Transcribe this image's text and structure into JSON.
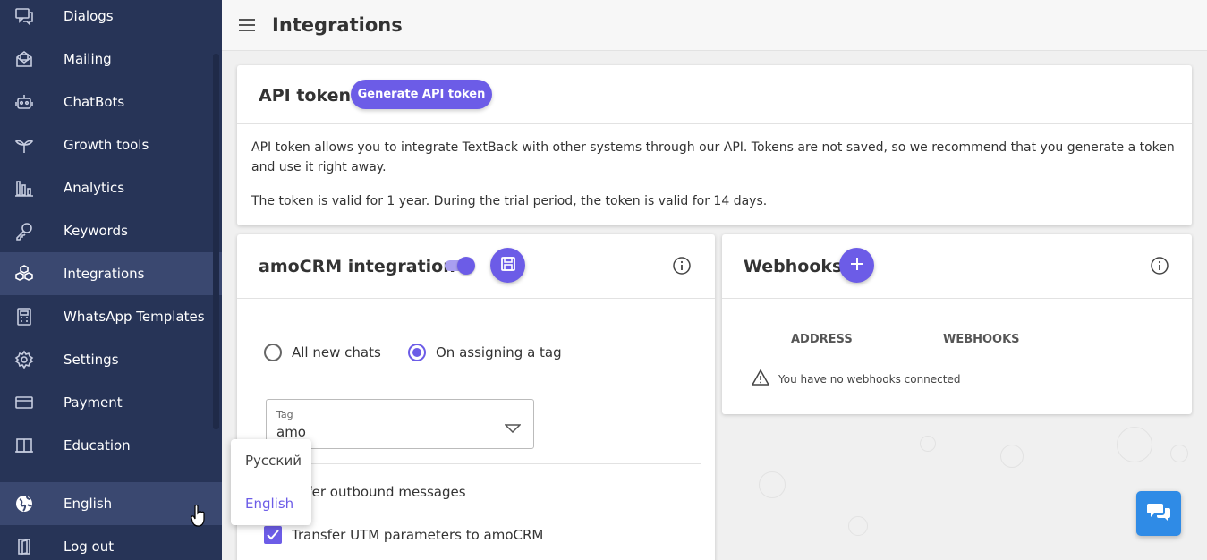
{
  "sidebar": {
    "items": [
      {
        "label": "Dialogs",
        "icon": "dialogs-icon"
      },
      {
        "label": "Mailing",
        "icon": "mailing-icon"
      },
      {
        "label": "ChatBots",
        "icon": "chatbots-icon"
      },
      {
        "label": "Growth tools",
        "icon": "growth-tools-icon"
      },
      {
        "label": "Analytics",
        "icon": "analytics-icon"
      },
      {
        "label": "Keywords",
        "icon": "keywords-icon"
      },
      {
        "label": "Integrations",
        "icon": "integrations-icon",
        "active": true
      },
      {
        "label": "WhatsApp Templates",
        "icon": "whatsapp-templates-icon"
      },
      {
        "label": "Settings",
        "icon": "settings-icon"
      },
      {
        "label": "Payment",
        "icon": "payment-icon"
      },
      {
        "label": "Education",
        "icon": "education-icon"
      }
    ],
    "language": {
      "label": "English",
      "icon": "globe-icon"
    },
    "logout": {
      "label": "Log out",
      "icon": "logout-icon"
    }
  },
  "language_menu": {
    "options": [
      "Русский",
      "English"
    ],
    "selected": "English"
  },
  "header": {
    "title": "Integrations",
    "menu_icon": "hamburger-icon"
  },
  "api_token": {
    "title": "API token",
    "button_label": "Generate API token",
    "description": "API token allows you to integrate TextBack with other systems through our API. Tokens are not saved, so we recommend that you generate a token and use it right away.",
    "validity": "The token is valid for 1 year. During the trial period, the token is valid for 14 days."
  },
  "amocrm": {
    "title": "amoCRM integration",
    "enabled": true,
    "save_icon": "save-icon",
    "info_icon": "info-icon",
    "radio_options": [
      {
        "label": "All new chats",
        "selected": false
      },
      {
        "label": "On assigning a tag",
        "selected": true
      }
    ],
    "tag_field": {
      "label": "Tag",
      "value": "amo"
    },
    "checkbox_1_visible_text": "nsfer outbound messages",
    "checkbox_2": {
      "label": "Transfer UTM parameters to amoCRM",
      "checked": true
    }
  },
  "webhooks": {
    "title": "Webhooks",
    "add_icon": "plus-icon",
    "info_icon": "info-icon",
    "columns": [
      "ADDRESS",
      "WEBHOOKS"
    ],
    "empty_message": "You have no webhooks connected"
  },
  "colors": {
    "sidebar_bg": "#273457",
    "sidebar_active": "#3a4870",
    "accent": "#6c5ce7",
    "chat_button": "#2f8be6"
  },
  "chat_button_icon": "chat-bubbles-icon"
}
